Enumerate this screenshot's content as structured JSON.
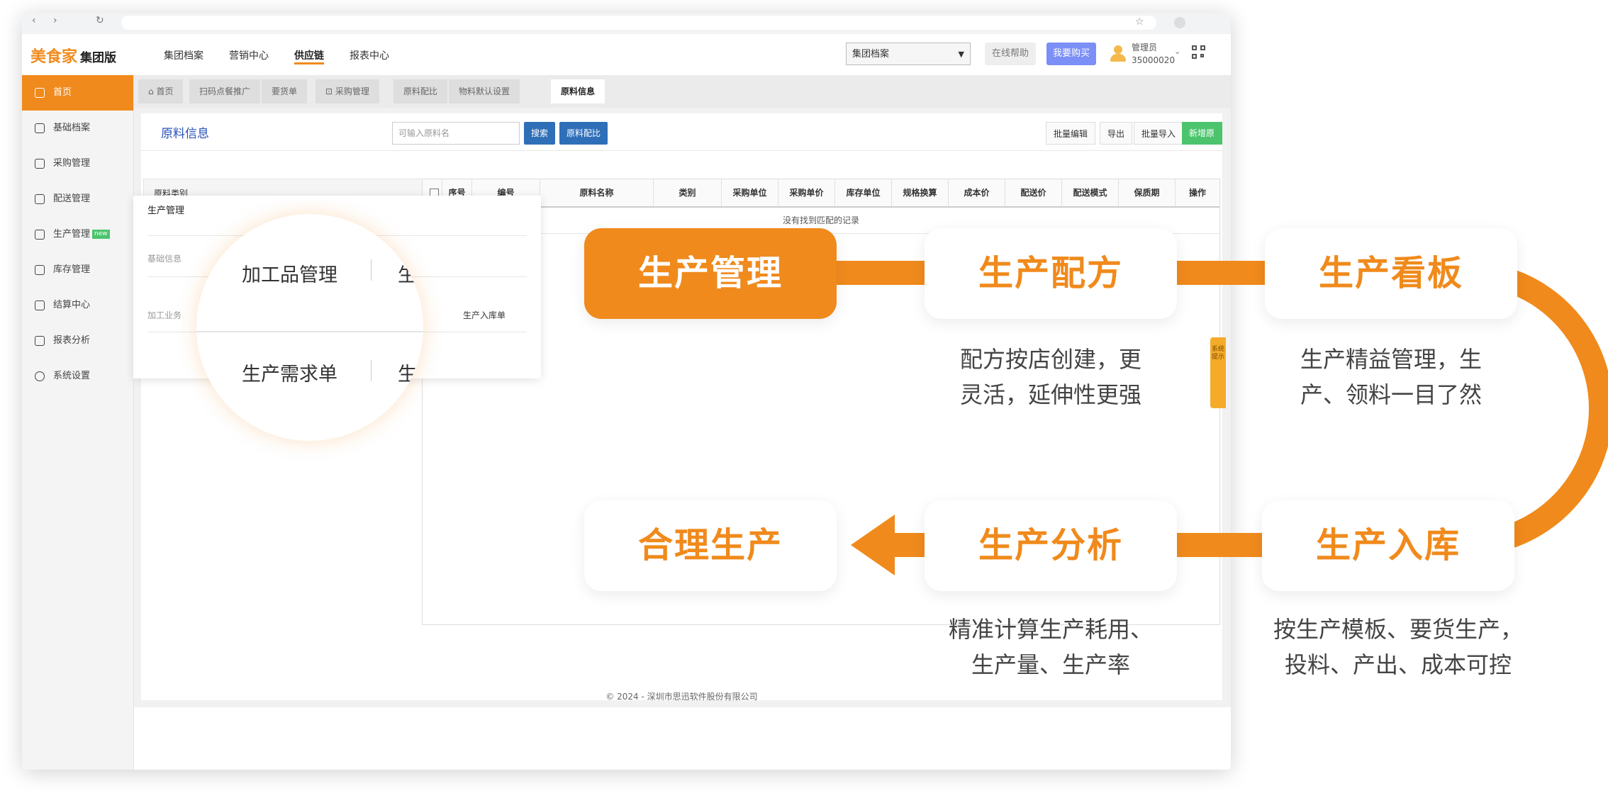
{
  "topbar": {
    "logo_main": "美食家",
    "logo_sub": "集团版",
    "nav": [
      "集团档案",
      "营销中心",
      "供应链",
      "报表中心"
    ],
    "group_select": "集团档案",
    "help": "在线帮助",
    "buy": "我要购买",
    "user_name": "管理员",
    "user_id": "35000020"
  },
  "sidebar": {
    "items": [
      {
        "label": "首页",
        "icon": "home-icon"
      },
      {
        "label": "基础档案",
        "icon": "archive-icon"
      },
      {
        "label": "采购管理",
        "icon": "cart-icon"
      },
      {
        "label": "配送管理",
        "icon": "truck-icon"
      },
      {
        "label": "生产管理",
        "icon": "production-icon",
        "badge": "new"
      },
      {
        "label": "库存管理",
        "icon": "warehouse-icon"
      },
      {
        "label": "结算中心",
        "icon": "settlement-icon"
      },
      {
        "label": "报表分析",
        "icon": "report-icon"
      },
      {
        "label": "系统设置",
        "icon": "settings-icon"
      }
    ]
  },
  "tabs": [
    "首页",
    "扫码点餐推广",
    "要货单",
    "采购管理",
    "原料配比",
    "物料默认设置",
    "原料信息"
  ],
  "panel": {
    "title": "原料信息",
    "search_placeholder": "可输入原料名",
    "search": "搜索",
    "ratio": "原料配比",
    "batch_edit": "批量编辑",
    "export": "导出",
    "batch_import": "批量导入",
    "add": "新增原料",
    "category": "原料类别"
  },
  "table": {
    "columns": [
      "序号",
      "编号",
      "原料名称",
      "类别",
      "采购单位",
      "采购单价",
      "库存单位",
      "规格换算",
      "成本价",
      "配送价",
      "配送模式",
      "保质期",
      "操作"
    ],
    "empty": "没有找到匹配的记录"
  },
  "dropdown": {
    "title": "生产管理",
    "basic": "基础信息",
    "process": "加工业务",
    "stock_in": "生产入库单"
  },
  "magnifier": {
    "item1": "加工品管理",
    "item1_cut": "生",
    "item2": "生产需求单",
    "item2_cut": "生"
  },
  "footer": "© 2024 - 深圳市思迅软件股份有限公司",
  "side_note": "系统提示",
  "flow": {
    "step1": "生产管理",
    "step2": "生产配方",
    "step2_desc": [
      "配方按店创建，更",
      "灵活，延伸性更强"
    ],
    "step3": "生产看板",
    "step3_desc": [
      "生产精益管理，生",
      "产、领料一目了然"
    ],
    "step4": "生产入库",
    "step4_desc": [
      "按生产模板、要货生产，",
      "投料、产出、成本可控"
    ],
    "step5": "生产分析",
    "step5_desc": [
      "精准计算生产耗用、",
      "生产量、生产率"
    ],
    "step6": "合理生产"
  },
  "colors": {
    "accent": "#f08a1c",
    "blue_button": "#2f6fb8",
    "green_button": "#4cc46d",
    "buy_button": "#7b8ff6"
  }
}
